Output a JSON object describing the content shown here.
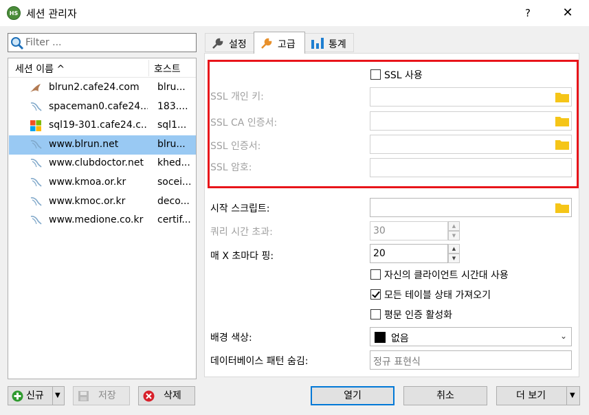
{
  "window": {
    "title": "세션 관리자",
    "help": "?",
    "close": "✕",
    "app_icon": "HS"
  },
  "filter": {
    "placeholder": "Filter ..."
  },
  "list": {
    "col_name": "세션 이름 ^",
    "col_host": "호스트",
    "rows": [
      {
        "name": "blrun2.cafe24.com",
        "host": "blru...",
        "icon": "mariadb-icon"
      },
      {
        "name": "spaceman0.cafe24....",
        "host": "183....",
        "icon": "mysql-icon"
      },
      {
        "name": "sql19-301.cafe24.c...",
        "host": "sql1...",
        "icon": "mssql-windows-icon"
      },
      {
        "name": "www.blrun.net",
        "host": "blru...",
        "icon": "mysql-icon",
        "selected": true
      },
      {
        "name": "www.clubdoctor.net",
        "host": "khed...",
        "icon": "mysql-icon"
      },
      {
        "name": "www.kmoa.or.kr",
        "host": "socei...",
        "icon": "mysql-icon"
      },
      {
        "name": "www.kmoc.or.kr",
        "host": "deco...",
        "icon": "mysql-icon"
      },
      {
        "name": "www.medione.co.kr",
        "host": "certif...",
        "icon": "mysql-icon"
      }
    ]
  },
  "buttons_left": {
    "new": "신규",
    "save": "저장",
    "delete": "삭제"
  },
  "tabs": [
    {
      "label": "설정",
      "icon": "wrench-icon"
    },
    {
      "label": "고급",
      "icon": "wrench-orange-icon",
      "active": true
    },
    {
      "label": "통계",
      "icon": "bar-chart-icon"
    }
  ],
  "ssl": {
    "use_ssl": "SSL 사용",
    "private_key": "SSL 개인 키:",
    "ca_cert": "SSL CA 인증서:",
    "cert": "SSL 인증서:",
    "cipher": "SSL 암호:"
  },
  "advanced": {
    "startup_script": "시작 스크립트:",
    "query_timeout": "쿼리 시간 초과:",
    "query_timeout_value": "30",
    "ping_every": "매 X 초마다 핑:",
    "ping_value": "20",
    "use_client_tz": "자신의 클라이언트 시간대 사용",
    "get_full_status": "모든 테이블 상태 가져오기",
    "cleartext_auth": "평문 인증 활성화",
    "bg_color": "배경 색상:",
    "bg_color_value": "없음",
    "hide_db_pattern": "데이터베이스 패턴 숨김:",
    "hide_db_placeholder": "정규 표현식"
  },
  "state": {
    "use_ssl": false,
    "use_client_tz": false,
    "get_full_status": true,
    "cleartext_auth": false
  },
  "buttons_bottom": {
    "open": "열기",
    "cancel": "취소",
    "more": "더 보기"
  }
}
